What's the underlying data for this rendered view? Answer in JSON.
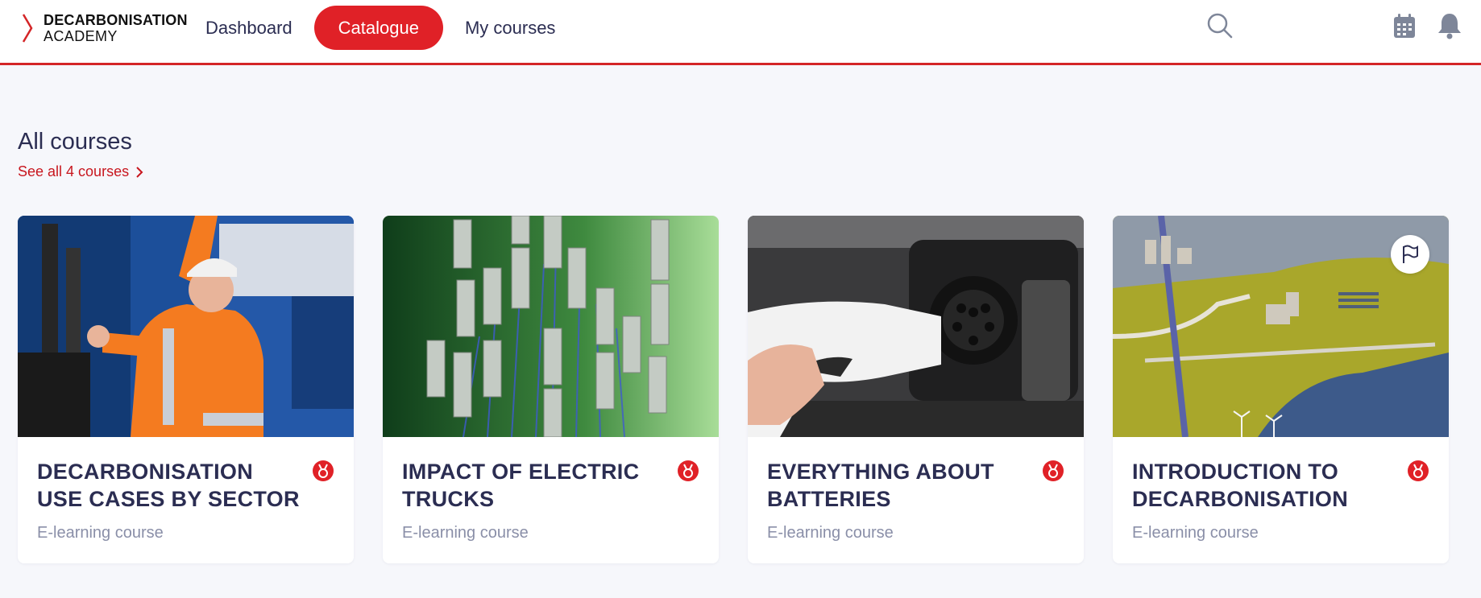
{
  "brand": {
    "line1": "DECARBONISATION",
    "line2": "ACADEMY"
  },
  "nav": [
    {
      "label": "Dashboard",
      "active": false
    },
    {
      "label": "Catalogue",
      "active": true
    },
    {
      "label": "My courses",
      "active": false
    }
  ],
  "header_icons": [
    "search-icon",
    "calendar-icon",
    "bell-icon"
  ],
  "section": {
    "title": "All courses",
    "see_all": "See all 4 courses"
  },
  "courses": [
    {
      "title": "Decarbonisation use cases by sector",
      "type": "E-learning course",
      "badge_icon": "medal-icon"
    },
    {
      "title": "Impact of electric trucks",
      "type": "E-learning course",
      "badge_icon": "medal-icon"
    },
    {
      "title": "Everything about batteries",
      "type": "E-learning course",
      "badge_icon": "medal-icon"
    },
    {
      "title": "Introduction to decarbonisation",
      "type": "E-learning course",
      "badge_icon": "medal-icon",
      "extra_icon": "flag-icon"
    }
  ],
  "colors": {
    "accent": "#e02127",
    "text": "#2b2d52",
    "muted": "#8a8fa8",
    "background": "#f6f7fb"
  }
}
